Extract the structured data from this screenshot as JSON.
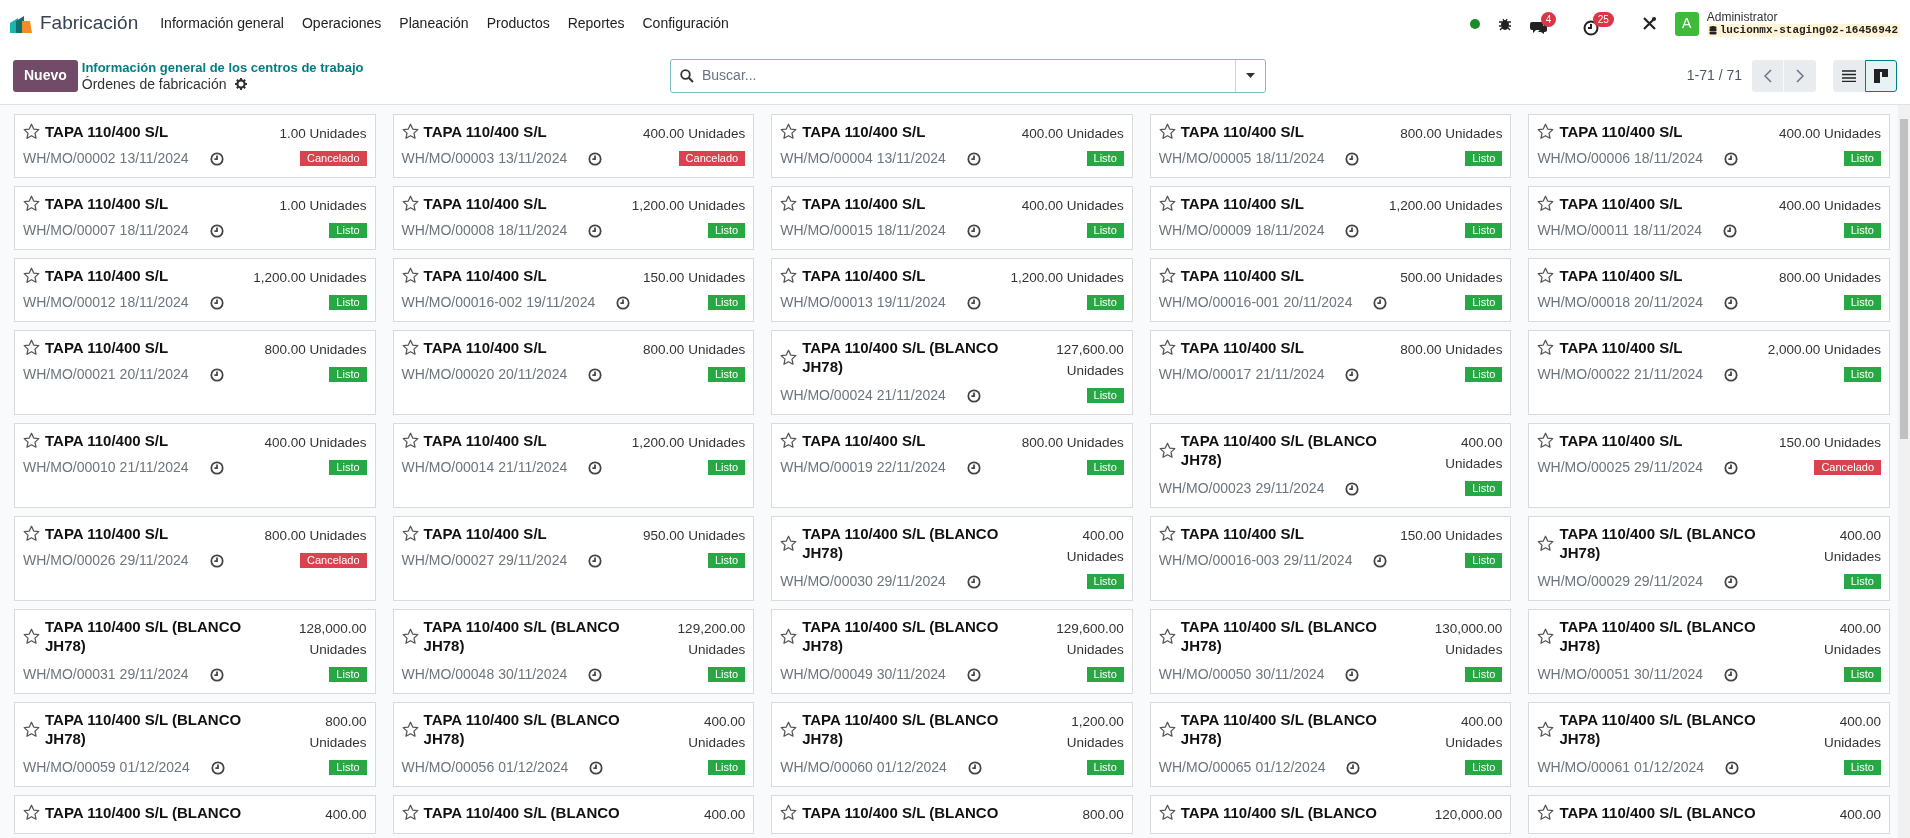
{
  "navbar": {
    "app_name": "Fabricación",
    "menus": [
      "Información general",
      "Operaciones",
      "Planeación",
      "Productos",
      "Reportes",
      "Configuración"
    ],
    "presence_online": true,
    "messages_count": "4",
    "activities_count": "25",
    "avatar_letter": "A",
    "user_name": "Administrator",
    "database": "lucionmx-staging02-16456942"
  },
  "control_panel": {
    "new_button": "Nuevo",
    "breadcrumb": "Información general de los centros de trabajo",
    "title": "Órdenes de fabricación",
    "search": {
      "placeholder": "Buscar..."
    },
    "pager": "1-71 / 71",
    "views": [
      {
        "kind": "list",
        "selected": false
      },
      {
        "kind": "kanban",
        "selected": true
      }
    ]
  },
  "cards": [
    {
      "name": "TAPA 110/400 S/L",
      "starred": false,
      "qty": "1.00",
      "unit": "Unidades",
      "ref": "WH/MO/00002",
      "date": "13/11/2024",
      "status": {
        "label": "Cancelado",
        "kind": "cancel"
      }
    },
    {
      "name": "TAPA 110/400 S/L",
      "starred": false,
      "qty": "400.00",
      "unit": "Unidades",
      "ref": "WH/MO/00003",
      "date": "13/11/2024",
      "status": {
        "label": "Cancelado",
        "kind": "cancel"
      }
    },
    {
      "name": "TAPA 110/400 S/L",
      "starred": false,
      "qty": "400.00",
      "unit": "Unidades",
      "ref": "WH/MO/00004",
      "date": "13/11/2024",
      "status": {
        "label": "Listo",
        "kind": "done"
      }
    },
    {
      "name": "TAPA 110/400 S/L",
      "starred": false,
      "qty": "800.00",
      "unit": "Unidades",
      "ref": "WH/MO/00005",
      "date": "18/11/2024",
      "status": {
        "label": "Listo",
        "kind": "done"
      }
    },
    {
      "name": "TAPA 110/400 S/L",
      "starred": false,
      "qty": "400.00",
      "unit": "Unidades",
      "ref": "WH/MO/00006",
      "date": "18/11/2024",
      "status": {
        "label": "Listo",
        "kind": "done"
      }
    },
    {
      "name": "TAPA 110/400 S/L",
      "starred": false,
      "qty": "1.00",
      "unit": "Unidades",
      "ref": "WH/MO/00007",
      "date": "18/11/2024",
      "status": {
        "label": "Listo",
        "kind": "done"
      }
    },
    {
      "name": "TAPA 110/400 S/L",
      "starred": false,
      "qty": "1,200.00",
      "unit": "Unidades",
      "ref": "WH/MO/00008",
      "date": "18/11/2024",
      "status": {
        "label": "Listo",
        "kind": "done"
      }
    },
    {
      "name": "TAPA 110/400 S/L",
      "starred": false,
      "qty": "400.00",
      "unit": "Unidades",
      "ref": "WH/MO/00015",
      "date": "18/11/2024",
      "status": {
        "label": "Listo",
        "kind": "done"
      }
    },
    {
      "name": "TAPA 110/400 S/L",
      "starred": false,
      "qty": "1,200.00",
      "unit": "Unidades",
      "ref": "WH/MO/00009",
      "date": "18/11/2024",
      "status": {
        "label": "Listo",
        "kind": "done"
      }
    },
    {
      "name": "TAPA 110/400 S/L",
      "starred": false,
      "qty": "400.00",
      "unit": "Unidades",
      "ref": "WH/MO/00011",
      "date": "18/11/2024",
      "status": {
        "label": "Listo",
        "kind": "done"
      }
    },
    {
      "name": "TAPA 110/400 S/L",
      "starred": false,
      "qty": "1,200.00",
      "unit": "Unidades",
      "ref": "WH/MO/00012",
      "date": "18/11/2024",
      "status": {
        "label": "Listo",
        "kind": "done"
      }
    },
    {
      "name": "TAPA 110/400 S/L",
      "starred": false,
      "qty": "150.00",
      "unit": "Unidades",
      "ref": "WH/MO/00016-002",
      "date": "19/11/2024",
      "status": {
        "label": "Listo",
        "kind": "done"
      }
    },
    {
      "name": "TAPA 110/400 S/L",
      "starred": false,
      "qty": "1,200.00",
      "unit": "Unidades",
      "ref": "WH/MO/00013",
      "date": "19/11/2024",
      "status": {
        "label": "Listo",
        "kind": "done"
      }
    },
    {
      "name": "TAPA 110/400 S/L",
      "starred": false,
      "qty": "500.00",
      "unit": "Unidades",
      "ref": "WH/MO/00016-001",
      "date": "20/11/2024",
      "status": {
        "label": "Listo",
        "kind": "done"
      }
    },
    {
      "name": "TAPA 110/400 S/L",
      "starred": false,
      "qty": "800.00",
      "unit": "Unidades",
      "ref": "WH/MO/00018",
      "date": "20/11/2024",
      "status": {
        "label": "Listo",
        "kind": "done"
      }
    },
    {
      "name": "TAPA 110/400 S/L",
      "starred": false,
      "qty": "800.00",
      "unit": "Unidades",
      "ref": "WH/MO/00021",
      "date": "20/11/2024",
      "status": {
        "label": "Listo",
        "kind": "done"
      }
    },
    {
      "name": "TAPA 110/400 S/L",
      "starred": false,
      "qty": "800.00",
      "unit": "Unidades",
      "ref": "WH/MO/00020",
      "date": "20/11/2024",
      "status": {
        "label": "Listo",
        "kind": "done"
      }
    },
    {
      "name": "TAPA 110/400 S/L (BLANCO JH78)",
      "starred": false,
      "qty": "127,600.00",
      "unit": "Unidades",
      "ref": "WH/MO/00024",
      "date": "21/11/2024",
      "status": {
        "label": "Listo",
        "kind": "done"
      }
    },
    {
      "name": "TAPA 110/400 S/L",
      "starred": false,
      "qty": "800.00",
      "unit": "Unidades",
      "ref": "WH/MO/00017",
      "date": "21/11/2024",
      "status": {
        "label": "Listo",
        "kind": "done"
      }
    },
    {
      "name": "TAPA 110/400 S/L",
      "starred": false,
      "qty": "2,000.00",
      "unit": "Unidades",
      "ref": "WH/MO/00022",
      "date": "21/11/2024",
      "status": {
        "label": "Listo",
        "kind": "done"
      }
    },
    {
      "name": "TAPA 110/400 S/L",
      "starred": false,
      "qty": "400.00",
      "unit": "Unidades",
      "ref": "WH/MO/00010",
      "date": "21/11/2024",
      "status": {
        "label": "Listo",
        "kind": "done"
      }
    },
    {
      "name": "TAPA 110/400 S/L",
      "starred": false,
      "qty": "1,200.00",
      "unit": "Unidades",
      "ref": "WH/MO/00014",
      "date": "21/11/2024",
      "status": {
        "label": "Listo",
        "kind": "done"
      }
    },
    {
      "name": "TAPA 110/400 S/L",
      "starred": false,
      "qty": "800.00",
      "unit": "Unidades",
      "ref": "WH/MO/00019",
      "date": "22/11/2024",
      "status": {
        "label": "Listo",
        "kind": "done"
      }
    },
    {
      "name": "TAPA 110/400 S/L (BLANCO JH78)",
      "starred": false,
      "qty": "400.00",
      "unit": "Unidades",
      "ref": "WH/MO/00023",
      "date": "29/11/2024",
      "status": {
        "label": "Listo",
        "kind": "done"
      }
    },
    {
      "name": "TAPA 110/400 S/L",
      "starred": false,
      "qty": "150.00",
      "unit": "Unidades",
      "ref": "WH/MO/00025",
      "date": "29/11/2024",
      "status": {
        "label": "Cancelado",
        "kind": "cancel"
      }
    },
    {
      "name": "TAPA 110/400 S/L",
      "starred": false,
      "qty": "800.00",
      "unit": "Unidades",
      "ref": "WH/MO/00026",
      "date": "29/11/2024",
      "status": {
        "label": "Cancelado",
        "kind": "cancel"
      }
    },
    {
      "name": "TAPA 110/400 S/L",
      "starred": false,
      "qty": "950.00",
      "unit": "Unidades",
      "ref": "WH/MO/00027",
      "date": "29/11/2024",
      "status": {
        "label": "Listo",
        "kind": "done"
      }
    },
    {
      "name": "TAPA 110/400 S/L (BLANCO JH78)",
      "starred": false,
      "qty": "400.00",
      "unit": "Unidades",
      "ref": "WH/MO/00030",
      "date": "29/11/2024",
      "status": {
        "label": "Listo",
        "kind": "done"
      }
    },
    {
      "name": "TAPA 110/400 S/L",
      "starred": false,
      "qty": "150.00",
      "unit": "Unidades",
      "ref": "WH/MO/00016-003",
      "date": "29/11/2024",
      "status": {
        "label": "Listo",
        "kind": "done"
      }
    },
    {
      "name": "TAPA 110/400 S/L (BLANCO JH78)",
      "starred": false,
      "qty": "400.00",
      "unit": "Unidades",
      "ref": "WH/MO/00029",
      "date": "29/11/2024",
      "status": {
        "label": "Listo",
        "kind": "done"
      }
    },
    {
      "name": "TAPA 110/400 S/L (BLANCO JH78)",
      "starred": false,
      "qty": "128,000.00",
      "unit": "Unidades",
      "ref": "WH/MO/00031",
      "date": "29/11/2024",
      "status": {
        "label": "Listo",
        "kind": "done"
      }
    },
    {
      "name": "TAPA 110/400 S/L (BLANCO JH78)",
      "starred": false,
      "qty": "129,200.00",
      "unit": "Unidades",
      "ref": "WH/MO/00048",
      "date": "30/11/2024",
      "status": {
        "label": "Listo",
        "kind": "done"
      }
    },
    {
      "name": "TAPA 110/400 S/L (BLANCO JH78)",
      "starred": false,
      "qty": "129,600.00",
      "unit": "Unidades",
      "ref": "WH/MO/00049",
      "date": "30/11/2024",
      "status": {
        "label": "Listo",
        "kind": "done"
      }
    },
    {
      "name": "TAPA 110/400 S/L (BLANCO JH78)",
      "starred": false,
      "qty": "130,000.00",
      "unit": "Unidades",
      "ref": "WH/MO/00050",
      "date": "30/11/2024",
      "status": {
        "label": "Listo",
        "kind": "done"
      }
    },
    {
      "name": "TAPA 110/400 S/L (BLANCO JH78)",
      "starred": false,
      "qty": "400.00",
      "unit": "Unidades",
      "ref": "WH/MO/00051",
      "date": "30/11/2024",
      "status": {
        "label": "Listo",
        "kind": "done"
      }
    },
    {
      "name": "TAPA 110/400 S/L (BLANCO JH78)",
      "starred": false,
      "qty": "800.00",
      "unit": "Unidades",
      "ref": "WH/MO/00059",
      "date": "01/12/2024",
      "status": {
        "label": "Listo",
        "kind": "done"
      }
    },
    {
      "name": "TAPA 110/400 S/L (BLANCO JH78)",
      "starred": false,
      "qty": "400.00",
      "unit": "Unidades",
      "ref": "WH/MO/00056",
      "date": "01/12/2024",
      "status": {
        "label": "Listo",
        "kind": "done"
      }
    },
    {
      "name": "TAPA 110/400 S/L (BLANCO JH78)",
      "starred": false,
      "qty": "1,200.00",
      "unit": "Unidades",
      "ref": "WH/MO/00060",
      "date": "01/12/2024",
      "status": {
        "label": "Listo",
        "kind": "done"
      }
    },
    {
      "name": "TAPA 110/400 S/L (BLANCO JH78)",
      "starred": false,
      "qty": "400.00",
      "unit": "Unidades",
      "ref": "WH/MO/00065",
      "date": "01/12/2024",
      "status": {
        "label": "Listo",
        "kind": "done"
      }
    },
    {
      "name": "TAPA 110/400 S/L (BLANCO JH78)",
      "starred": false,
      "qty": "400.00",
      "unit": "Unidades",
      "ref": "WH/MO/00061",
      "date": "01/12/2024",
      "status": {
        "label": "Listo",
        "kind": "done"
      }
    },
    {
      "name": "TAPA 110/400 S/L (BLANCO",
      "starred": false,
      "qty": "400.00"
    },
    {
      "name": "TAPA 110/400 S/L (BLANCO",
      "starred": false,
      "qty": "400.00"
    },
    {
      "name": "TAPA 110/400 S/L (BLANCO",
      "starred": false,
      "qty": "800.00"
    },
    {
      "name": "TAPA 110/400 S/L (BLANCO",
      "starred": false,
      "qty": "120,000.00"
    },
    {
      "name": "TAPA 110/400 S/L (BLANCO",
      "starred": false,
      "qty": "400.00"
    }
  ]
}
